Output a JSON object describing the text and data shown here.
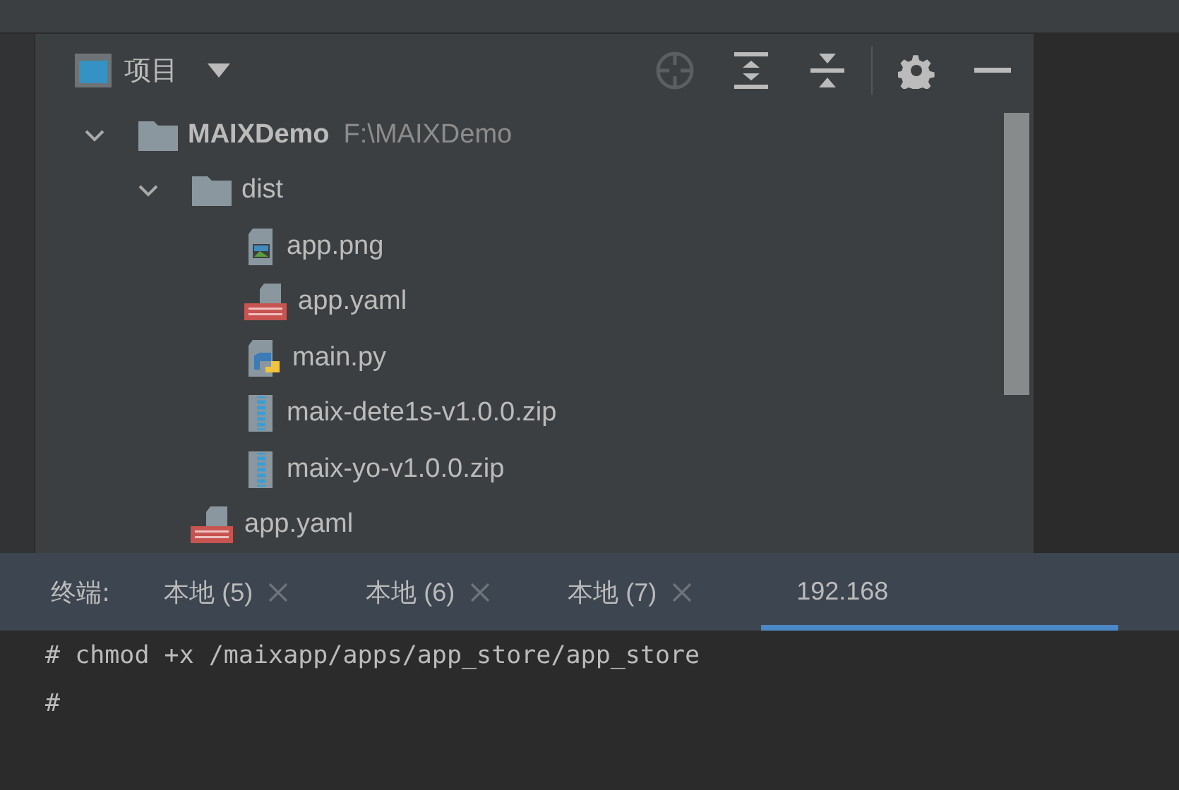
{
  "project_panel": {
    "title": "项目",
    "tree": [
      {
        "name": "MAIXDemo",
        "path": "F:\\MAIXDemo",
        "kind": "folder",
        "expanded": true,
        "children": [
          {
            "name": "dist",
            "kind": "folder",
            "expanded": true,
            "children": [
              {
                "name": "app.png",
                "kind": "image"
              },
              {
                "name": "app.yaml",
                "kind": "yaml"
              },
              {
                "name": "main.py",
                "kind": "python"
              },
              {
                "name": "maix-dete1s-v1.0.0.zip",
                "kind": "zip"
              },
              {
                "name": "maix-yo-v1.0.0.zip",
                "kind": "zip"
              }
            ]
          },
          {
            "name": "app.yaml",
            "kind": "yaml"
          }
        ]
      }
    ]
  },
  "terminal": {
    "label": "终端:",
    "tabs": [
      {
        "label": "本地 (5)",
        "selected": false,
        "closable": true
      },
      {
        "label": "本地 (6)",
        "selected": false,
        "closable": true
      },
      {
        "label": "本地 (7)",
        "selected": false,
        "closable": true
      },
      {
        "label": "192.168",
        "selected": true,
        "closable": false
      }
    ],
    "lines": [
      "# chmod +x /maixapp/apps/app_store/app_store",
      "#"
    ]
  }
}
